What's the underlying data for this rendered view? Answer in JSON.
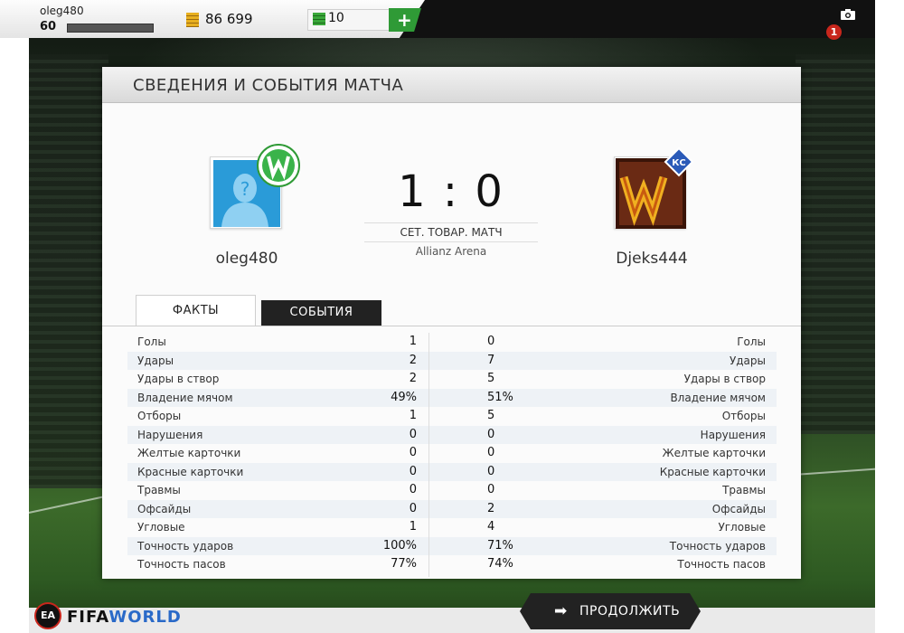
{
  "topbar": {
    "username": "oleg480",
    "level": "60",
    "coins": "86 699",
    "tokens": "10",
    "add_label": "+",
    "notifications": "1",
    "icons": {
      "coins": "coins-icon",
      "tokens": "tokens-icon",
      "camera": "camera-icon"
    }
  },
  "panel": {
    "title": "СВЕДЕНИЯ И СОБЫТИЯ МАТЧА",
    "home_team": "oleg480",
    "away_team": "Djeks444",
    "score": "1 : 0",
    "match_type": "СЕТ. ТОВАР. МАТЧ",
    "venue": "Allianz Arena",
    "tabs": [
      {
        "label": "ФАКТЫ",
        "active": true
      },
      {
        "label": "СОБЫТИЯ",
        "active": false
      }
    ]
  },
  "stats": [
    {
      "label": "Голы",
      "home": "1",
      "away": "0"
    },
    {
      "label": "Удары",
      "home": "2",
      "away": "7"
    },
    {
      "label": "Удары в створ",
      "home": "2",
      "away": "5"
    },
    {
      "label": "Владение мячом",
      "home": "49%",
      "away": "51%"
    },
    {
      "label": "Отборы",
      "home": "1",
      "away": "5"
    },
    {
      "label": "Нарушения",
      "home": "0",
      "away": "0"
    },
    {
      "label": "Желтые карточки",
      "home": "0",
      "away": "0"
    },
    {
      "label": "Красные карточки",
      "home": "0",
      "away": "0"
    },
    {
      "label": "Травмы",
      "home": "0",
      "away": "0"
    },
    {
      "label": "Офсайды",
      "home": "0",
      "away": "2"
    },
    {
      "label": "Угловые",
      "home": "1",
      "away": "4"
    },
    {
      "label": "Точность ударов",
      "home": "100%",
      "away": "71%"
    },
    {
      "label": "Точность пасов",
      "home": "77%",
      "away": "74%"
    }
  ],
  "footer": {
    "continue_label": "ПРОДОЛЖИТЬ",
    "brand_ea": "EA",
    "brand_fifa": "FIFA",
    "brand_world": "WORLD"
  },
  "colors": {
    "accent_green": "#2f9a36",
    "badge_red": "#c8261c",
    "dark": "#222222"
  }
}
